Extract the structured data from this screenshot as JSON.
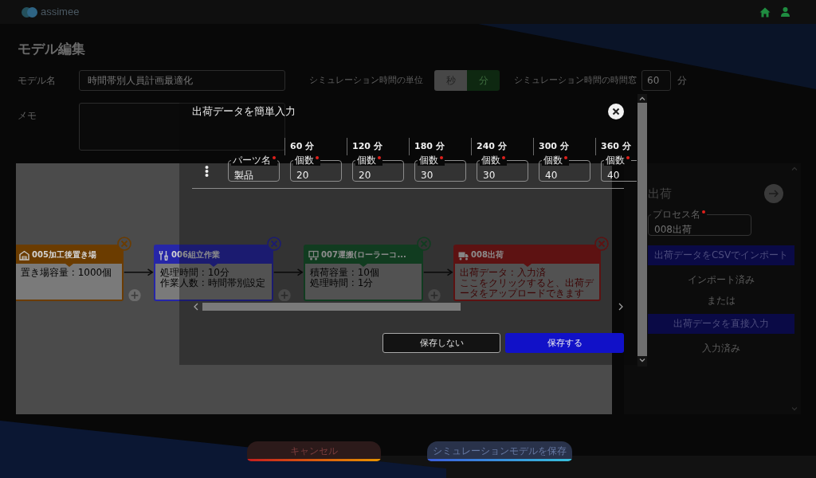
{
  "header": {
    "logo_text": "assimee"
  },
  "page_title": "モデル編集",
  "form": {
    "model_name": {
      "label": "モデル名",
      "value": "時間帯別人員計画最適化"
    },
    "time_unit": {
      "label": "シミュレーション時間の単位",
      "options": [
        {
          "label": "秒",
          "selected": false
        },
        {
          "label": "分",
          "selected": true
        }
      ]
    },
    "time_window": {
      "label": "シミュレーション時間の時間窓",
      "value": "60",
      "unit": "分"
    },
    "memo": {
      "label": "メモ"
    }
  },
  "canvas": {
    "nodes": [
      {
        "kind": "storage",
        "title": "005加工後置き場",
        "details": [
          "置き場容量 : 1000個"
        ]
      },
      {
        "kind": "work",
        "title": "006組立作業",
        "details": [
          "処理時間 : 10分",
          "作業人数 : 時間帯別設定"
        ]
      },
      {
        "kind": "transport",
        "title": "007運搬(ローラーコ...",
        "details": [
          "積荷容量 : 10個",
          "処理時間 : 1分"
        ]
      },
      {
        "kind": "shipping",
        "title": "008出荷",
        "details": [
          "出荷データ : 入力済",
          "ここをクリックすると、出荷データをアップロードできます"
        ]
      }
    ]
  },
  "side_panel": {
    "title": "出荷",
    "process_name": {
      "label": "プロセス名",
      "required": true,
      "value": "008出荷"
    },
    "actions": [
      {
        "kind": "button",
        "label": "出荷データをCSVでインポート"
      },
      {
        "kind": "status",
        "label": "インポート済み"
      },
      {
        "kind": "separator",
        "label": "または"
      },
      {
        "kind": "button",
        "label": "出荷データを直接入力"
      },
      {
        "kind": "status",
        "label": "入力済み"
      }
    ]
  },
  "footer": {
    "buttons": [
      {
        "kind": "cancel",
        "label": "キャンセル"
      },
      {
        "kind": "save",
        "label": "シミュレーションモデルを保存"
      }
    ]
  },
  "modal": {
    "title": "出荷データを簡単入力",
    "columns": [
      "60 分",
      "120 分",
      "180 分",
      "240 分",
      "300 分",
      "360 分"
    ],
    "rows": [
      {
        "part": {
          "label": "パーツ名",
          "required": true,
          "value": "製品"
        },
        "quantities": [
          {
            "label": "個数",
            "required": true,
            "value": "20"
          },
          {
            "label": "個数",
            "required": true,
            "value": "20"
          },
          {
            "label": "個数",
            "required": true,
            "value": "30"
          },
          {
            "label": "個数",
            "required": true,
            "value": "30"
          },
          {
            "label": "個数",
            "required": true,
            "value": "40"
          },
          {
            "label": "個数",
            "required": true,
            "value": "40"
          }
        ]
      }
    ],
    "buttons": [
      {
        "kind": "secondary",
        "label": "保存しない"
      },
      {
        "kind": "primary",
        "label": "保存する"
      }
    ]
  }
}
